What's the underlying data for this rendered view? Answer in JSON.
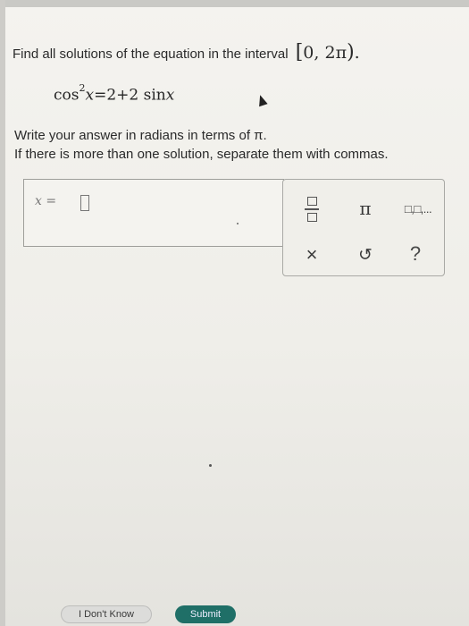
{
  "problem": {
    "prompt": "Find all solutions of the equation in the interval",
    "interval": {
      "open": "[",
      "a": "0",
      "sep": ", ",
      "b": "2π",
      "close": ")",
      "end": "."
    },
    "equation": {
      "fn": "cos",
      "power": "2",
      "var": "x",
      "rhs": "=2+2 sin",
      "var2": "x"
    },
    "instruction_line1": "Write your answer in radians in terms of π.",
    "instruction_line2": "If there is more than one solution, separate them with commas."
  },
  "answer": {
    "var": "x",
    "eq": " = ",
    "value": ""
  },
  "keypad": {
    "pi_label": "π",
    "list_label": "□,□,...",
    "clear_label": "×",
    "undo_label": "↺",
    "help_label": "?"
  },
  "footer": {
    "dont_know_label": "I Don't Know",
    "submit_label": "Submit"
  },
  "colors": {
    "submit_bg": "#1f6f67",
    "dont_know_bg": "#dcdcda",
    "background": "#f4f3ef"
  },
  "icons": [
    "fraction-icon",
    "pi-icon",
    "list-icon",
    "clear-icon",
    "undo-icon",
    "help-icon"
  ]
}
